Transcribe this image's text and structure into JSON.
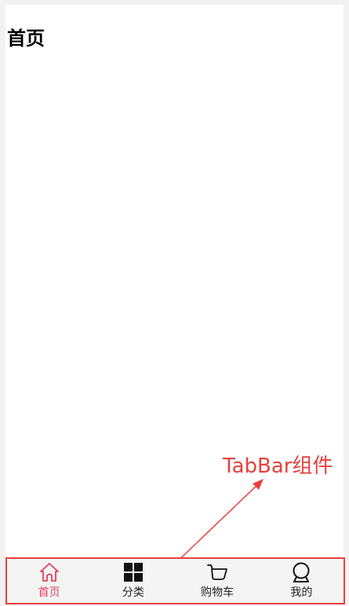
{
  "page": {
    "title": "首页"
  },
  "annotation": {
    "text": "TabBar组件",
    "color": "#e8403d"
  },
  "tabbar": {
    "active_color": "#e5405e",
    "items": [
      {
        "label": "首页",
        "icon": "home-icon",
        "active": true
      },
      {
        "label": "分类",
        "icon": "category-grid-icon",
        "active": false
      },
      {
        "label": "购物车",
        "icon": "shopping-cart-icon",
        "active": false
      },
      {
        "label": "我的",
        "icon": "profile-icon",
        "active": false
      }
    ]
  }
}
